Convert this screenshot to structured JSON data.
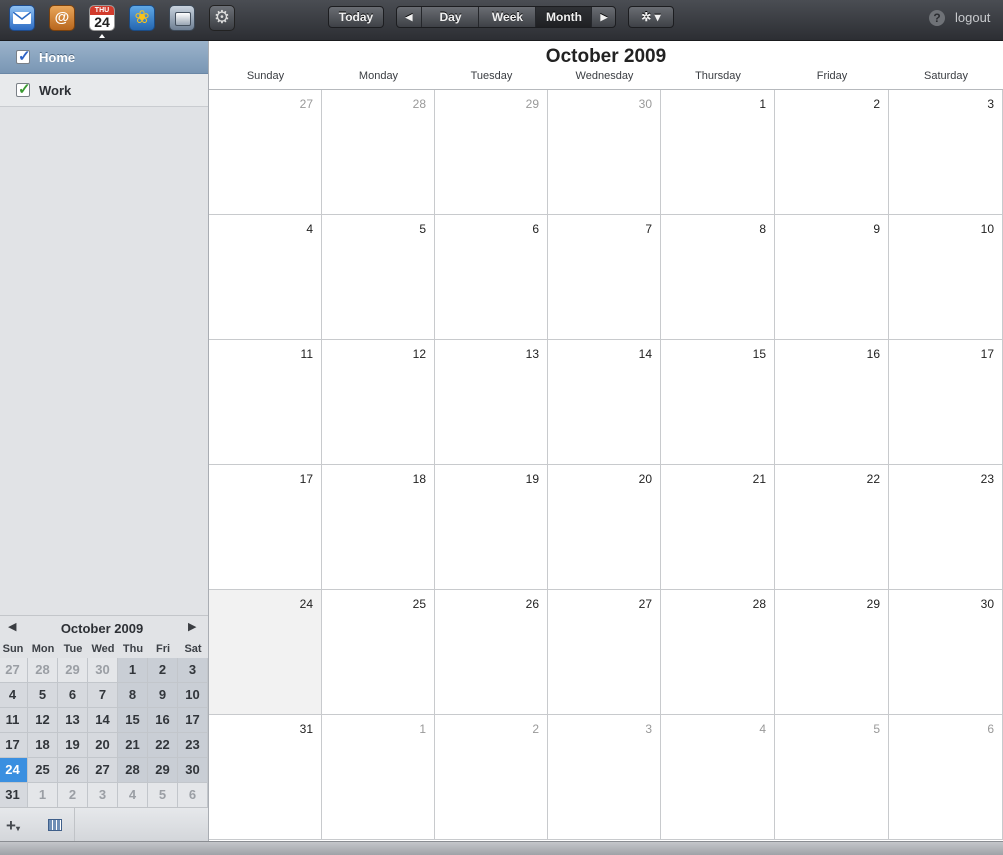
{
  "toolbar": {
    "apps": [
      {
        "name": "mail-icon"
      },
      {
        "name": "contacts-icon",
        "glyph": "@"
      },
      {
        "name": "calendar-icon",
        "weekday": "THU",
        "day": "24"
      },
      {
        "name": "photos-icon",
        "glyph": "❀"
      },
      {
        "name": "idisk-icon"
      },
      {
        "name": "settings-icon",
        "glyph": "⚙"
      }
    ],
    "today_label": "Today",
    "prev_glyph": "◀",
    "next_glyph": "▶",
    "views": {
      "day": "Day",
      "week": "Week",
      "month": "Month"
    },
    "active_view": "Month",
    "gear_glyph": "✲ ▾",
    "help_glyph": "?",
    "logout_label": "logout"
  },
  "sidebar": {
    "calendars": [
      {
        "label": "Home",
        "selected": true,
        "check_color": "#2f63c6"
      },
      {
        "label": "Work",
        "selected": false,
        "check_color": "#3a9a31"
      }
    ],
    "check_glyph": "✓",
    "mini_calendar": {
      "title": "October 2009",
      "prev_glyph": "◀",
      "next_glyph": "▶",
      "weekday_headers": [
        "Sun",
        "Mon",
        "Tue",
        "Wed",
        "Thu",
        "Fri",
        "Sat"
      ],
      "weeks": [
        [
          "27",
          "28",
          "29",
          "30",
          "1",
          "2",
          "3"
        ],
        [
          "4",
          "5",
          "6",
          "7",
          "8",
          "9",
          "10"
        ],
        [
          "11",
          "12",
          "13",
          "14",
          "15",
          "16",
          "17"
        ],
        [
          "17",
          "18",
          "19",
          "20",
          "21",
          "22",
          "23"
        ],
        [
          "24",
          "25",
          "26",
          "27",
          "28",
          "29",
          "30"
        ],
        [
          "31",
          "1",
          "2",
          "3",
          "4",
          "5",
          "6"
        ]
      ],
      "today": "24"
    },
    "footer": {
      "add_glyph": "+",
      "add_caret": "▾"
    }
  },
  "main": {
    "title": "October 2009",
    "weekdays": [
      "Sunday",
      "Monday",
      "Tuesday",
      "Wednesday",
      "Thursday",
      "Friday",
      "Saturday"
    ],
    "weeks": [
      [
        "27",
        "28",
        "29",
        "30",
        "1",
        "2",
        "3"
      ],
      [
        "4",
        "5",
        "6",
        "7",
        "8",
        "9",
        "10"
      ],
      [
        "11",
        "12",
        "13",
        "14",
        "15",
        "16",
        "17"
      ],
      [
        "17",
        "18",
        "19",
        "20",
        "21",
        "22",
        "23"
      ],
      [
        "24",
        "25",
        "26",
        "27",
        "28",
        "29",
        "30"
      ],
      [
        "31",
        "1",
        "2",
        "3",
        "4",
        "5",
        "6"
      ]
    ],
    "today": "24"
  }
}
